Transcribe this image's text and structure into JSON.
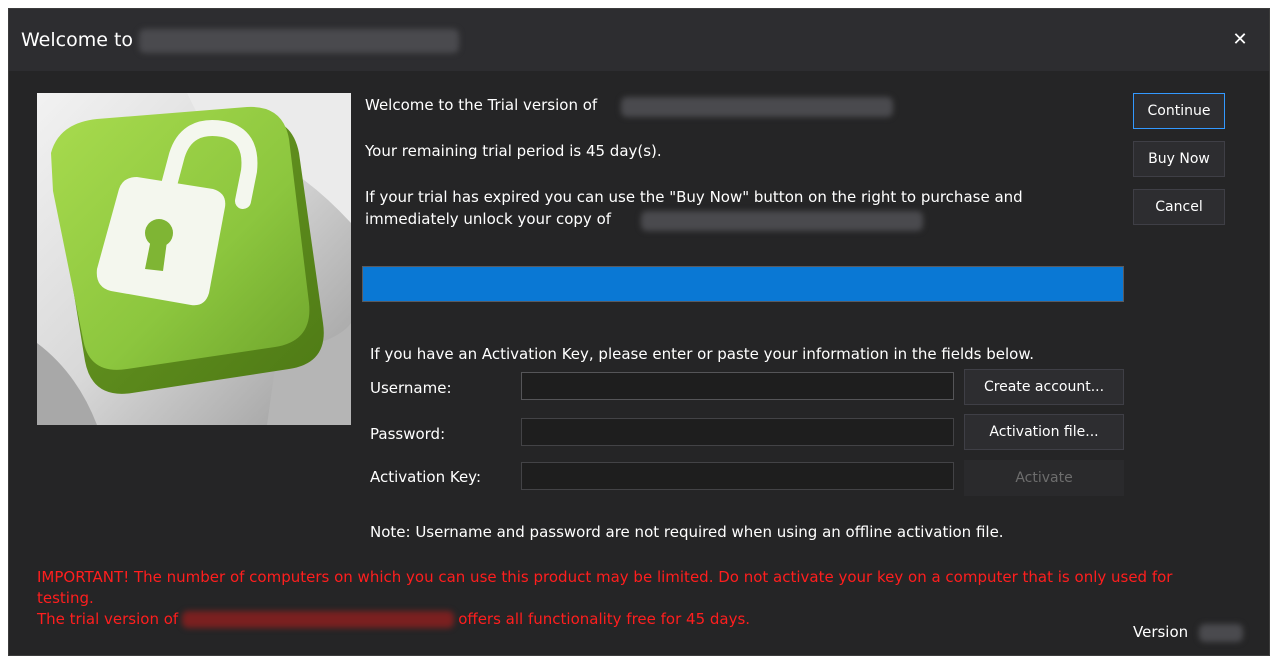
{
  "window": {
    "title": "Welcome to",
    "close_glyph": "✕"
  },
  "hero": {
    "icon": "unlocked-padlock-key-icon",
    "accent_color": "#8dc63f"
  },
  "info": {
    "line1": "Welcome to the Trial version of",
    "line2": "Your remaining trial period is 45 day(s).",
    "line3a": "If your trial has expired you can use the \"Buy Now\" button on the right to purchase and",
    "line3b": "immediately unlock your copy of"
  },
  "progress": {
    "value_percent": 100,
    "color": "#0a78d4"
  },
  "activation": {
    "intro": "If you have an Activation Key, please enter or paste your information in the fields below.",
    "username_label": "Username:",
    "username_value": "",
    "password_label": "Password:",
    "password_value": "",
    "key_label": "Activation Key:",
    "key_value": "",
    "note": "Note: Username and password are not required when using an offline activation file."
  },
  "buttons": {
    "continue": "Continue",
    "buy_now": "Buy Now",
    "cancel": "Cancel",
    "create_account": "Create account...",
    "activation_file": "Activation file...",
    "activate": "Activate"
  },
  "important": {
    "line1": "IMPORTANT! The number of computers on which you can use this product may be limited. Do not activate your key on a computer that is only used for testing.",
    "line2_prefix": "The trial version of",
    "line2_suffix": "offers all functionality free for 45 days.",
    "color": "#ff1e1e"
  },
  "footer": {
    "version_label": "Version"
  }
}
